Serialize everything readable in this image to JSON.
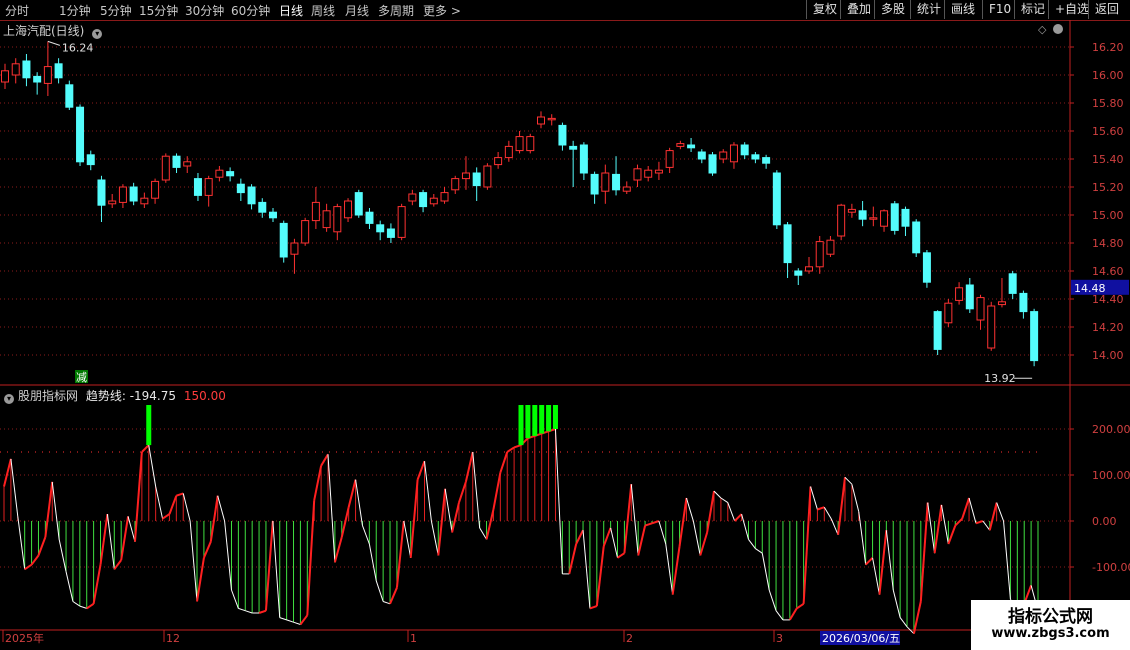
{
  "toolbar": {
    "periods": [
      "分时",
      "1分钟",
      "5分钟",
      "15分钟",
      "30分钟",
      "60分钟",
      "日线",
      "周线",
      "月线",
      "多周期",
      "更多 >"
    ],
    "active_period": "日线",
    "right_buttons": [
      "复权",
      "叠加",
      "多股",
      "统计",
      "画线",
      "F10",
      "标记",
      "+自选",
      "返回"
    ]
  },
  "price_panel": {
    "title": "上海汽配(日线)",
    "high_label": "16.24",
    "low_label": "13.92",
    "current_price": "14.48",
    "marker": "减"
  },
  "indicator_panel": {
    "name": "股朋指标网",
    "line_label": "趋势线: -194.75",
    "value_label": "150.00"
  },
  "date_axis": {
    "labels": [
      "2025年",
      "12",
      "1",
      "2",
      "3"
    ],
    "cursor_date": "2026/03/06/五"
  },
  "watermark": {
    "line1": "指标公式网",
    "line2": "www.zbgs3.com"
  },
  "colors": {
    "up": "#ff3232",
    "down": "#54fcfc",
    "grid": "#8b1c1c",
    "axis": "#c02020",
    "signal": "#00ff00",
    "trend_up": "#ff2020",
    "trend_down": "#ffffff"
  },
  "chart_data": [
    {
      "type": "candlestick",
      "title": "上海汽配(日线)",
      "ylim": [
        13.85,
        16.3
      ],
      "yticks": [
        14.0,
        14.2,
        14.4,
        14.6,
        14.8,
        15.0,
        15.2,
        15.4,
        15.6,
        15.8,
        16.0,
        16.2
      ],
      "bars": [
        [
          "up",
          15.95,
          16.03,
          16.08,
          15.9
        ],
        [
          "up",
          16.0,
          16.08,
          16.12,
          15.94
        ],
        [
          "down",
          16.1,
          15.98,
          16.15,
          15.92
        ],
        [
          "down",
          15.99,
          15.95,
          16.02,
          15.86
        ],
        [
          "up",
          15.94,
          16.06,
          16.24,
          15.85
        ],
        [
          "down",
          16.08,
          15.98,
          16.12,
          15.94
        ],
        [
          "down",
          15.93,
          15.77,
          15.96,
          15.75
        ],
        [
          "down",
          15.77,
          15.38,
          15.79,
          15.35
        ],
        [
          "down",
          15.43,
          15.36,
          15.46,
          15.32
        ],
        [
          "down",
          15.25,
          15.07,
          15.28,
          14.95
        ],
        [
          "up",
          15.08,
          15.1,
          15.15,
          15.05
        ],
        [
          "up",
          15.09,
          15.2,
          15.22,
          15.05
        ],
        [
          "down",
          15.2,
          15.1,
          15.23,
          15.07
        ],
        [
          "up",
          15.08,
          15.12,
          15.16,
          15.05
        ],
        [
          "up",
          15.12,
          15.24,
          15.26,
          15.08
        ],
        [
          "up",
          15.25,
          15.42,
          15.44,
          15.23
        ],
        [
          "down",
          15.42,
          15.34,
          15.44,
          15.3
        ],
        [
          "up",
          15.35,
          15.38,
          15.42,
          15.3
        ],
        [
          "down",
          15.26,
          15.14,
          15.3,
          15.1
        ],
        [
          "up",
          15.14,
          15.26,
          15.28,
          15.06
        ],
        [
          "up",
          15.27,
          15.32,
          15.35,
          15.24
        ],
        [
          "down",
          15.31,
          15.28,
          15.34,
          15.24
        ],
        [
          "down",
          15.22,
          15.16,
          15.26,
          15.1
        ],
        [
          "down",
          15.2,
          15.08,
          15.22,
          15.04
        ],
        [
          "down",
          15.09,
          15.02,
          15.12,
          14.98
        ],
        [
          "down",
          15.02,
          14.98,
          15.05,
          14.95
        ],
        [
          "down",
          14.94,
          14.7,
          14.96,
          14.66
        ],
        [
          "up",
          14.72,
          14.8,
          14.83,
          14.58
        ],
        [
          "up",
          14.8,
          14.96,
          14.98,
          14.78
        ],
        [
          "up",
          14.96,
          15.09,
          15.2,
          14.9
        ],
        [
          "up",
          14.91,
          15.03,
          15.08,
          14.88
        ],
        [
          "up",
          14.88,
          15.06,
          15.08,
          14.82
        ],
        [
          "up",
          14.98,
          15.1,
          15.12,
          14.95
        ],
        [
          "down",
          15.16,
          15.0,
          15.18,
          14.98
        ],
        [
          "down",
          15.02,
          14.94,
          15.05,
          14.9
        ],
        [
          "down",
          14.93,
          14.88,
          14.96,
          14.82
        ],
        [
          "down",
          14.9,
          14.84,
          14.94,
          14.8
        ],
        [
          "up",
          14.84,
          15.06,
          15.08,
          14.82
        ],
        [
          "up",
          15.1,
          15.15,
          15.18,
          15.07
        ],
        [
          "down",
          15.16,
          15.06,
          15.18,
          15.02
        ],
        [
          "up",
          15.08,
          15.12,
          15.15,
          15.06
        ],
        [
          "up",
          15.1,
          15.16,
          15.2,
          15.08
        ],
        [
          "up",
          15.18,
          15.26,
          15.28,
          15.15
        ],
        [
          "up",
          15.26,
          15.3,
          15.42,
          15.18
        ],
        [
          "down",
          15.3,
          15.21,
          15.34,
          15.1
        ],
        [
          "up",
          15.2,
          15.35,
          15.37,
          15.18
        ],
        [
          "up",
          15.36,
          15.41,
          15.45,
          15.33
        ],
        [
          "up",
          15.41,
          15.49,
          15.53,
          15.38
        ],
        [
          "up",
          15.46,
          15.56,
          15.6,
          15.44
        ],
        [
          "up",
          15.46,
          15.56,
          15.58,
          15.44
        ],
        [
          "up",
          15.65,
          15.7,
          15.74,
          15.62
        ],
        [
          "up",
          15.68,
          15.69,
          15.72,
          15.64
        ],
        [
          "down",
          15.64,
          15.5,
          15.66,
          15.46
        ],
        [
          "down",
          15.49,
          15.47,
          15.53,
          15.2
        ],
        [
          "down",
          15.5,
          15.3,
          15.52,
          15.25
        ],
        [
          "down",
          15.29,
          15.15,
          15.31,
          15.08
        ],
        [
          "up",
          15.17,
          15.3,
          15.36,
          15.08
        ],
        [
          "down",
          15.29,
          15.18,
          15.42,
          15.14
        ],
        [
          "up",
          15.17,
          15.2,
          15.24,
          15.15
        ],
        [
          "up",
          15.25,
          15.33,
          15.36,
          15.2
        ],
        [
          "up",
          15.27,
          15.32,
          15.35,
          15.24
        ],
        [
          "up",
          15.3,
          15.32,
          15.38,
          15.25
        ],
        [
          "up",
          15.34,
          15.46,
          15.48,
          15.3
        ],
        [
          "up",
          15.49,
          15.51,
          15.53,
          15.47
        ],
        [
          "down",
          15.5,
          15.48,
          15.55,
          15.45
        ],
        [
          "down",
          15.45,
          15.4,
          15.47,
          15.37
        ],
        [
          "down",
          15.43,
          15.3,
          15.45,
          15.28
        ],
        [
          "up",
          15.4,
          15.45,
          15.47,
          15.37
        ],
        [
          "up",
          15.38,
          15.5,
          15.52,
          15.33
        ],
        [
          "down",
          15.5,
          15.43,
          15.52,
          15.4
        ],
        [
          "down",
          15.43,
          15.4,
          15.45,
          15.37
        ],
        [
          "down",
          15.41,
          15.37,
          15.43,
          15.33
        ],
        [
          "down",
          15.3,
          14.93,
          15.32,
          14.9
        ],
        [
          "down",
          14.93,
          14.66,
          14.95,
          14.55
        ],
        [
          "down",
          14.6,
          14.57,
          14.62,
          14.5
        ],
        [
          "up",
          14.6,
          14.63,
          14.7,
          14.58
        ],
        [
          "up",
          14.63,
          14.81,
          14.85,
          14.58
        ],
        [
          "up",
          14.72,
          14.82,
          14.85,
          14.7
        ],
        [
          "up",
          14.85,
          15.07,
          15.08,
          14.82
        ],
        [
          "up",
          15.02,
          15.04,
          15.08,
          14.98
        ],
        [
          "down",
          15.03,
          14.97,
          15.1,
          14.92
        ],
        [
          "up",
          14.97,
          14.98,
          15.06,
          14.92
        ],
        [
          "up",
          14.92,
          15.03,
          15.04,
          14.88
        ],
        [
          "down",
          15.08,
          14.89,
          15.1,
          14.86
        ],
        [
          "down",
          15.04,
          14.92,
          15.06,
          14.85
        ],
        [
          "down",
          14.95,
          14.73,
          14.97,
          14.7
        ],
        [
          "down",
          14.73,
          14.52,
          14.75,
          14.48
        ],
        [
          "down",
          14.31,
          14.04,
          14.32,
          14.0
        ],
        [
          "up",
          14.23,
          14.37,
          14.4,
          14.2
        ],
        [
          "up",
          14.39,
          14.48,
          14.52,
          14.36
        ],
        [
          "down",
          14.5,
          14.33,
          14.55,
          14.3
        ],
        [
          "up",
          14.25,
          14.41,
          14.43,
          14.18
        ],
        [
          "up",
          14.05,
          14.35,
          14.38,
          14.03
        ],
        [
          "up",
          14.36,
          14.38,
          14.55,
          14.34
        ],
        [
          "down",
          14.58,
          14.44,
          14.6,
          14.4
        ],
        [
          "down",
          14.44,
          14.31,
          14.46,
          14.26
        ],
        [
          "down",
          14.31,
          13.96,
          14.33,
          13.92
        ]
      ]
    },
    {
      "type": "bar",
      "title": "股朋指标网",
      "series_name": "趋势线",
      "current_value": -194.75,
      "ylim": [
        -250,
        280
      ],
      "yticks": [
        -100.0,
        0.0,
        100.0,
        200.0
      ],
      "reference_line": 150.0,
      "values": [
        75,
        135,
        10,
        -105,
        -95,
        -75,
        -35,
        85,
        -40,
        -110,
        -175,
        -185,
        -190,
        -180,
        -95,
        15,
        -105,
        -85,
        10,
        -45,
        150,
        165,
        75,
        5,
        15,
        55,
        60,
        0,
        -175,
        -80,
        -45,
        55,
        0,
        -150,
        -190,
        -195,
        -200,
        -200,
        -195,
        0,
        -210,
        -215,
        -220,
        -225,
        -205,
        45,
        120,
        145,
        -90,
        -35,
        30,
        90,
        -10,
        -50,
        -130,
        -175,
        -180,
        -145,
        0,
        -80,
        90,
        130,
        0,
        -75,
        70,
        -25,
        40,
        85,
        150,
        -15,
        -40,
        25,
        105,
        150,
        160,
        165,
        180,
        185,
        190,
        195,
        200,
        -115,
        -115,
        -50,
        -20,
        -190,
        -185,
        -55,
        -15,
        -80,
        -70,
        80,
        -75,
        -10,
        -5,
        0,
        -50,
        -160,
        -55,
        50,
        0,
        -75,
        -25,
        65,
        50,
        40,
        0,
        15,
        -40,
        -60,
        -70,
        -150,
        -195,
        -215,
        -215,
        -190,
        -180,
        75,
        25,
        30,
        5,
        -30,
        95,
        80,
        20,
        -95,
        -80,
        -160,
        -20,
        -150,
        -210,
        -230,
        -245,
        -175,
        40,
        -70,
        35,
        -50,
        -10,
        5,
        50,
        -5,
        0,
        -20,
        40,
        0,
        -170,
        -195,
        -180,
        -140,
        -195
      ]
    }
  ]
}
